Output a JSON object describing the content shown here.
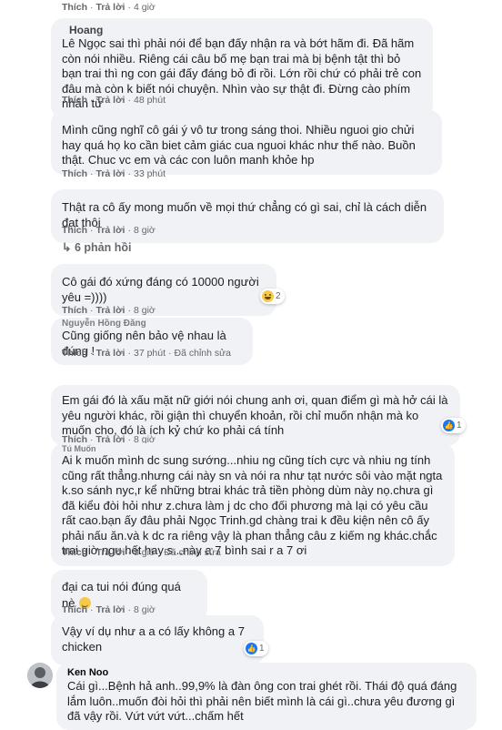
{
  "c0": {
    "like": "Thích",
    "reply": "Trả lời",
    "time": "4 giờ"
  },
  "c1": {
    "author": "Hoang",
    "text": "Lê Ngọc sai thì phải nói để bạn đấy nhận ra và bớt hãm đi. Đã hãm còn nói nhiều. Riêng cái câu bố mẹ bạn trai mà bị bệnh tật thì bỏ bạn trai thì ng con gái đấy đáng bỏ đi rồi. Lớn rồi chứ có phải trẻ con đâu mà còn k biết nói chuyện. Nhìn vào sự thật đi. Đừng cào phím nhân từ",
    "like": "Thích",
    "reply": "Trả lời",
    "time": "48 phút"
  },
  "c2": {
    "text": "Mình cũng nghĩ cô gái ý vô tư trong sáng thoi. Nhiều nguoi gio chửi hay quá họ ko cần biet cảm giác cua nguoi khác như thế nào. Buồn thật. Chuc vc em và các con luôn manh khỏe hp",
    "like": "Thích",
    "reply": "Trả lời",
    "time": "33 phút"
  },
  "c3": {
    "text": "Thật ra cô ấy mong muốn về mọi thứ chẳng có gì sai, chỉ là cách diễn đạt thôi",
    "like": "Thích",
    "reply": "Trả lời",
    "time": "8 giờ",
    "replies": "6 phản hồi"
  },
  "c4": {
    "text": "Cô gái đó xứng đáng có 10000 người yêu =))))",
    "react_count": "2",
    "like": "Thích",
    "reply": "Trả lời",
    "time": "8 giờ"
  },
  "c5": {
    "author": "Nguyễn Hồng Đăng",
    "text": "Cũng giống nên bảo vệ nhau là đúng !",
    "like": "Thích",
    "reply": "Trả lời",
    "time": "37 phút",
    "edited": "Đã chỉnh sửa"
  },
  "c6": {
    "text": "Em gái đó là xấu mặt nữ giới nói chung anh ơi, quan điểm gì mà hở cái là yêu người khác, rồi giận thì chuyển khoản, rồi chỉ muốn nhận mà ko muốn cho, đó là ích kỷ chứ ko phải cá tính",
    "react_count": "1",
    "like": "Thích",
    "reply": "Trả lời",
    "time": "8 giờ"
  },
  "c7": {
    "author": "Tú Muốn",
    "text": "Ai k muốn mình dc sung sướng...nhiu ng cũng tích cực và nhiu ng tính cũng rất thẳng.nhưng cái này sn và nói ra như tạt nước sôi vào mặt ngta k.so sánh nyc,r kể những btrai khác trả tiền phòng dùm này nọ.chưa gì đã kiểu đòi hỏi như z.chưa làm j dc cho đối phương mà lại có yêu cầu rất cao.bạn ấy đâu phải Ngọc Trinh.gd chàng trai k đều kiện nên cô ấy phải nấu ăn.và k dc ra riêng vậy là phan thẳng câu z kiếm ng khác.chắc trai giờ ngu hết hay s...này a 7 bình sai r a 7 ơi",
    "like": "Thích",
    "reply": "Trả lời",
    "time": "8 giờ",
    "edited": "Đã chỉnh sửa"
  },
  "c8": {
    "text": "đại ca tui nói đúng quá nè",
    "like": "Thích",
    "reply": "Trả lời",
    "time": "8 giờ"
  },
  "c9": {
    "text": "Vậy ví dụ như a a có lấy không a 7 chicken",
    "react_count": "1"
  },
  "c10": {
    "author": "Ken Noo",
    "text": "Cái gì...Bệnh hả anh..99,9% là đàn ông con trai ghét rồi. Thái độ quá đáng lắm luôn..muốn đòi hỏi thì phải nên biết mình là cái gì..chưa yêu đương gì đã vậy rồi. Vứt vứt vứt...chấm hết"
  }
}
